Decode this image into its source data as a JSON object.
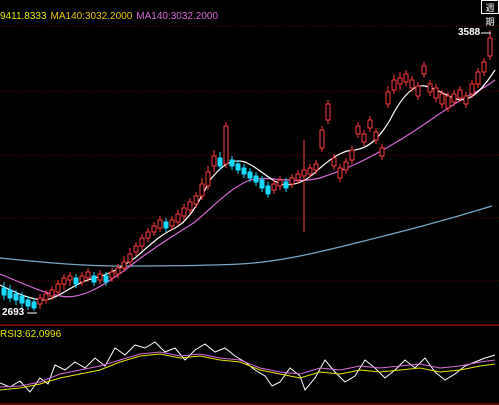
{
  "legend": {
    "ma_short": "9411.8333",
    "ma140_a": "MA140:3032.2000",
    "ma140_b": "MA140:3032.2000"
  },
  "rsi_legend": "RSI3:62.0996",
  "labels": {
    "high": "3588",
    "low": "2693"
  },
  "corner_button": "週期",
  "colors": {
    "up": "#ff3b3b",
    "down": "#19d9ff",
    "ma_fast": "#ffffff",
    "ma_mid": "#d86bd8",
    "ma_long": "#7aa7c7",
    "grid": "#8b0000",
    "legend_ma_short": "#e6e600",
    "legend_ma140_a": "#e6c200",
    "legend_ma140_b": "#d86bd8"
  },
  "chart_data": {
    "type": "candlestick",
    "price_high_label": 3588,
    "price_low_label": 2693,
    "indicators": [
      "MA140",
      "RSI3"
    ]
  }
}
